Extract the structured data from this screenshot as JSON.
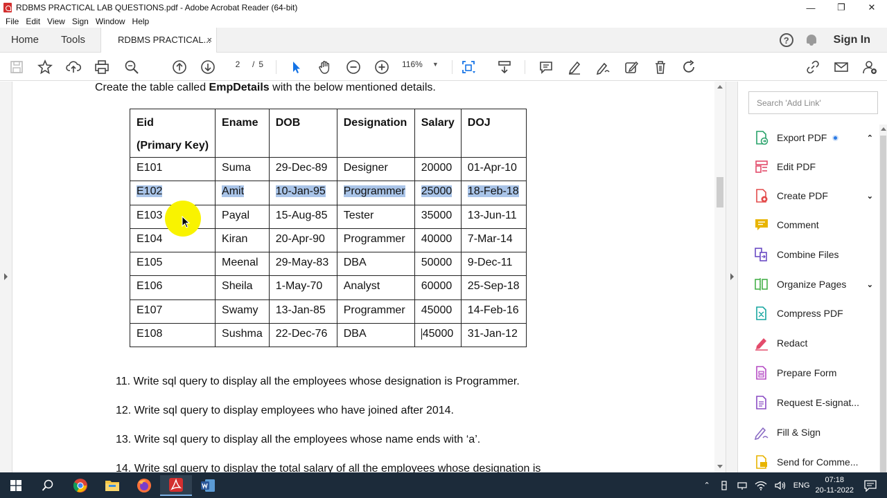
{
  "window": {
    "title": "RDBMS PRACTICAL LAB QUESTIONS.pdf - Adobe Acrobat Reader (64-bit)",
    "controls": [
      "—",
      "❐",
      "✕"
    ]
  },
  "menu": [
    "File",
    "Edit",
    "View",
    "Sign",
    "Window",
    "Help"
  ],
  "tabs": {
    "home": "Home",
    "tools": "Tools",
    "document": "RDBMS PRACTICAL...",
    "close": "×",
    "help": "?",
    "signin": "Sign In"
  },
  "toolbar": {
    "page_current": "2",
    "page_separator": "/",
    "page_total": "5",
    "zoom": "116%",
    "zoom_dropdown": "▼"
  },
  "document": {
    "intro_prefix": "Create the table called ",
    "intro_bold": "EmpDetails",
    "intro_suffix": " with the below mentioned details.",
    "headers": [
      "Eid",
      "(Primary Key)",
      "Ename",
      "DOB",
      "Designation",
      "Salary",
      "DOJ"
    ],
    "rows": [
      {
        "eid": "E101",
        "ename": "Suma",
        "dob": "29-Dec-89",
        "designation": "Designer",
        "salary": "20000",
        "doj": "01-Apr-10"
      },
      {
        "eid": "E102",
        "ename": "Amit",
        "dob": "10-Jan-95",
        "designation": "Programmer",
        "salary": "25000",
        "doj": "18-Feb-18"
      },
      {
        "eid": "E103",
        "ename": "Payal",
        "dob": "15-Aug-85",
        "designation": "Tester",
        "salary": "35000",
        "doj": "13-Jun-11"
      },
      {
        "eid": "E104",
        "ename": "Kiran",
        "dob": "20-Apr-90",
        "designation": "Programmer",
        "salary": "40000",
        "doj": "7-Mar-14"
      },
      {
        "eid": "E105",
        "ename": "Meenal",
        "dob": "29-May-83",
        "designation": "DBA",
        "salary": "50000",
        "doj": "9-Dec-11"
      },
      {
        "eid": "E106",
        "ename": "Sheila",
        "dob": "1-May-70",
        "designation": "Analyst",
        "salary": "60000",
        "doj": "25-Sep-18"
      },
      {
        "eid": "E107",
        "ename": "Swamy",
        "dob": "13-Jan-85",
        "designation": "Programmer",
        "salary": "45000",
        "doj": "14-Feb-16"
      },
      {
        "eid": "E108",
        "ename": "Sushma",
        "dob": "22-Dec-76",
        "designation": "DBA",
        "salary": "45000",
        "doj": "31-Jan-12"
      }
    ],
    "questions": [
      "11. Write sql query to display all the employees whose designation is Programmer.",
      "12. Write sql query to display employees who have joined after 2014.",
      "13. Write sql query to display all the employees whose name ends with ‘a’.",
      "14.  Write sql query to display the total salary of all the employees whose designation is"
    ]
  },
  "right_panel": {
    "search_placeholder": "Search 'Add Link'",
    "items": [
      {
        "label": "Export PDF",
        "color": "#26a269"
      },
      {
        "label": "Edit PDF",
        "color": "#e34b6b"
      },
      {
        "label": "Create PDF",
        "color": "#e34b4b"
      },
      {
        "label": "Comment",
        "color": "#e8b400"
      },
      {
        "label": "Combine Files",
        "color": "#6a4bc4"
      },
      {
        "label": "Organize Pages",
        "color": "#46b04a"
      },
      {
        "label": "Compress PDF",
        "color": "#17a6a0"
      },
      {
        "label": "Redact",
        "color": "#e34b6b"
      },
      {
        "label": "Prepare Form",
        "color": "#b54bc4"
      },
      {
        "label": "Request E-signat...",
        "color": "#8a4bc4"
      },
      {
        "label": "Fill & Sign",
        "color": "#8a6bc4"
      },
      {
        "label": "Send for Comme...",
        "color": "#e8b400"
      }
    ]
  },
  "taskbar": {
    "lang": "ENG",
    "time": "07:18",
    "date": "20-11-2022"
  },
  "colors": {
    "selection_highlight": "#a9c4e8",
    "pointer_highlight": "#f9f300",
    "taskbar_bg": "#1c2b3a",
    "accent": "#2c7be5"
  }
}
